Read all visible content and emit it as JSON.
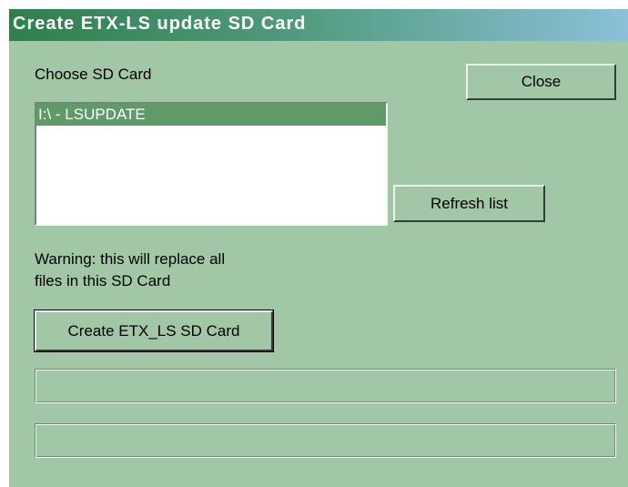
{
  "window": {
    "title": "Create ETX-LS update SD Card"
  },
  "sd_section": {
    "label": "Choose SD Card",
    "items": [
      {
        "label": "I:\\ - LSUPDATE",
        "selected": true
      }
    ]
  },
  "buttons": {
    "close": "Close",
    "refresh": "Refresh list",
    "create": "Create ETX_LS SD Card"
  },
  "warning": {
    "line1": "Warning: this will replace all",
    "line2": "files in this SD Card"
  },
  "progress": {
    "bar1_value": 0,
    "bar2_value": 0
  },
  "colors": {
    "window_bg": "#a2c7a6",
    "selection": "#5f9a68",
    "title_text": "#ffffff"
  }
}
